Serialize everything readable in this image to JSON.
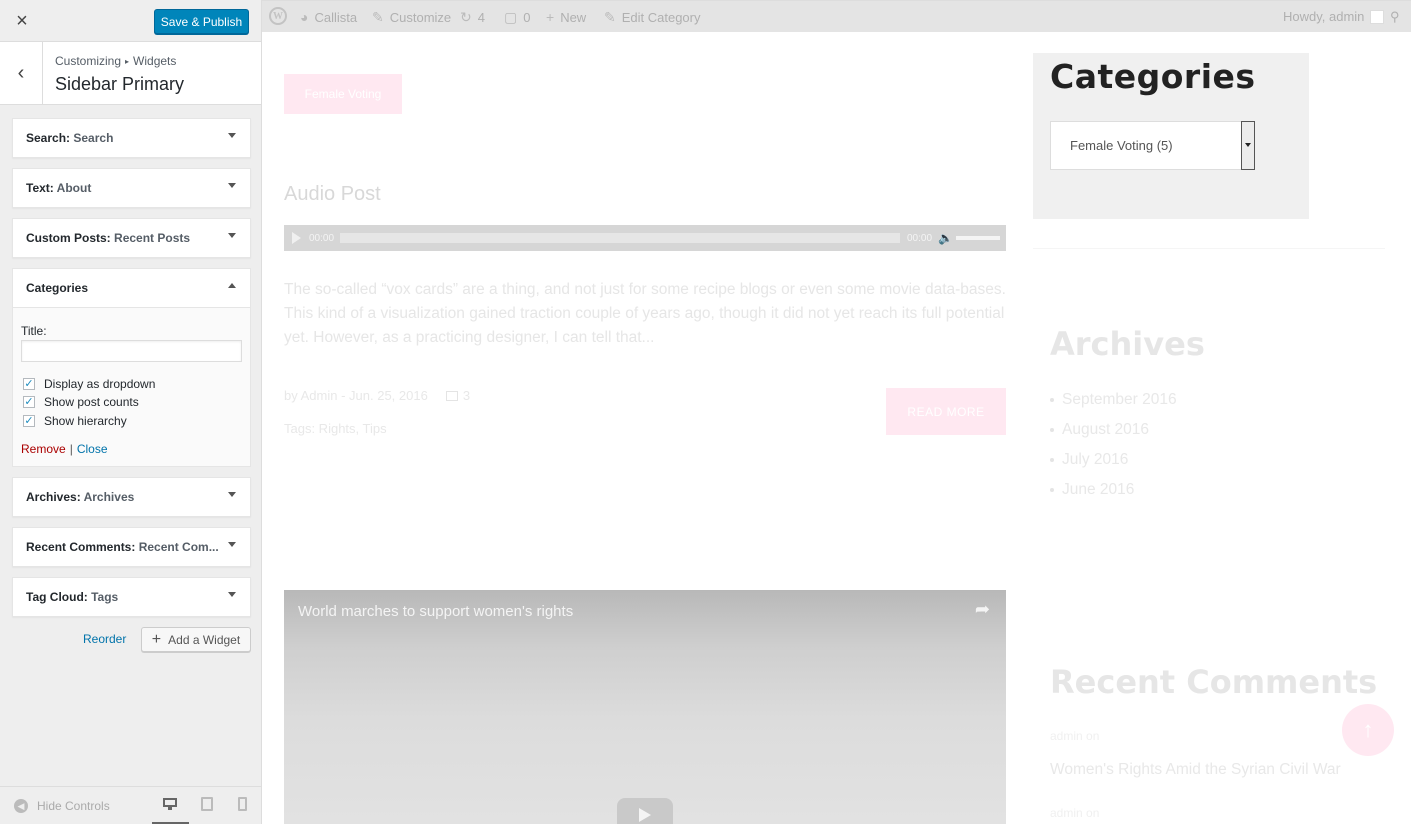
{
  "panel": {
    "close_icon": "×",
    "save_label": "Save & Publish",
    "back_icon": "‹",
    "breadcrumb": {
      "root": "Customizing",
      "sep": "▸",
      "current": "Widgets"
    },
    "section_title": "Sidebar Primary",
    "widgets_top": [
      {
        "type": "Search:",
        "name": "Search"
      },
      {
        "type": "Text:",
        "name": "About"
      },
      {
        "type": "Custom Posts:",
        "name": "Recent Posts"
      }
    ],
    "categories_widget": {
      "title": "Categories",
      "title_label": "Title:",
      "title_value": "",
      "options": [
        {
          "label": "Display as dropdown",
          "checked": true
        },
        {
          "label": "Show post counts",
          "checked": true
        },
        {
          "label": "Show hierarchy",
          "checked": true
        }
      ],
      "remove_label": "Remove",
      "links_sep": "|",
      "close_label": "Close"
    },
    "widgets_bottom": [
      {
        "type": "Archives:",
        "name": "Archives"
      },
      {
        "type": "Recent Comments:",
        "name": "Recent Com..."
      },
      {
        "type": "Tag Cloud:",
        "name": "Tags"
      }
    ],
    "reorder_label": "Reorder",
    "add_widget_label": "Add a Widget",
    "add_widget_icon": "+",
    "hide_controls_label": "Hide Controls"
  },
  "adminbar": {
    "logo": "W",
    "site_name": "Callista",
    "customize": "Customize",
    "updates_count": "4",
    "comments_count": "0",
    "new_label": "New",
    "edit_label": "Edit Category",
    "howdy": "Howdy, admin"
  },
  "post": {
    "category_pill": "Female Voting",
    "title": "Audio Post",
    "audio_time_start": "00:00",
    "audio_time_end": "00:00",
    "excerpt": "The so-called “vox cards” are a thing, and not just for some recipe blogs or even some movie data-bases. This kind of a visualization gained traction couple of years ago, though it did not yet reach its full potential yet. However, as a practicing designer, I can tell that...",
    "meta": "by Admin - Jun. 25, 2016",
    "comment_count": "3",
    "tags": "Tags: Rights, Tips",
    "read_more": "READ MORE"
  },
  "video": {
    "title": "World marches to support women's rights",
    "share_icon": "➦"
  },
  "sidebar_preview": {
    "categories_heading": "Categories",
    "categories_select": "Female Voting  (5)",
    "archives_heading": "Archives",
    "archives": [
      "September 2016",
      "August 2016",
      "July 2016",
      "June 2016"
    ],
    "recent_comments_heading": "Recent Comments",
    "rc_author_1": "admin on",
    "rc_link_1": "Women's Rights Amid the Syrian Civil War",
    "rc_author_2": "admin on"
  },
  "scroll_top_icon": "↑",
  "colors": {
    "primary": "#0085ba",
    "accent_pink": "#ffe8f1",
    "remove": "#aa0000",
    "link": "#0073aa"
  }
}
